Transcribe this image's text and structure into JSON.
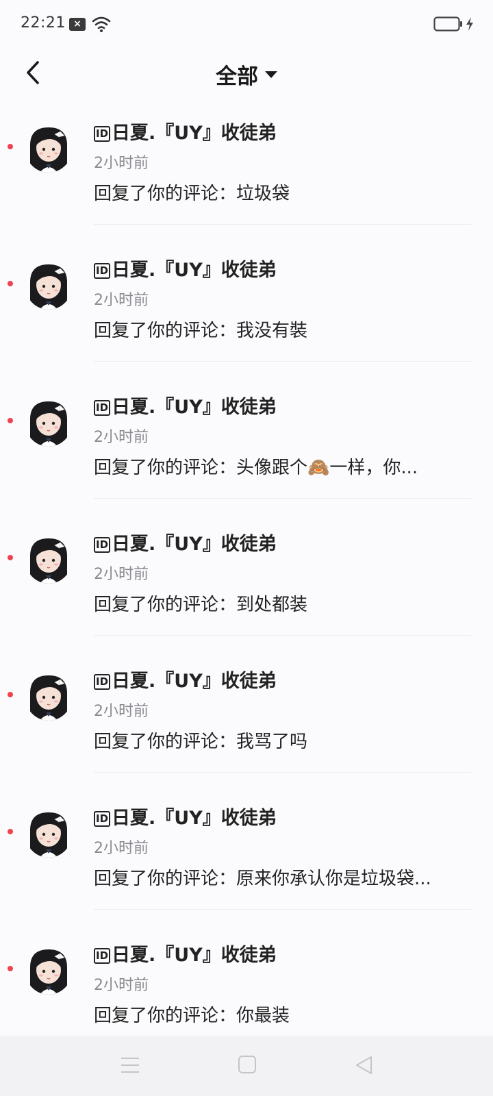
{
  "status": {
    "time": "22:21",
    "notif_icon": "x-icon",
    "wifi_icon": "wifi-icon",
    "battery_icon": "battery-icon"
  },
  "header": {
    "back_icon": "chevron-left-icon",
    "title": "全部",
    "dropdown_icon": "caret-down-icon"
  },
  "notifications": [
    {
      "id_badge": "ID",
      "user": "日夏.『UY』收徒弟",
      "time": "2小时前",
      "text": "回复了你的评论：垃圾袋",
      "unread": true
    },
    {
      "id_badge": "ID",
      "user": "日夏.『UY』收徒弟",
      "time": "2小时前",
      "text": "回复了你的评论：我没有裝",
      "unread": true
    },
    {
      "id_badge": "ID",
      "user": "日夏.『UY』收徒弟",
      "time": "2小时前",
      "text": "回复了你的评论：头像跟个🙈一样，你...",
      "unread": true
    },
    {
      "id_badge": "ID",
      "user": "日夏.『UY』收徒弟",
      "time": "2小时前",
      "text": "回复了你的评论：到处都装",
      "unread": true
    },
    {
      "id_badge": "ID",
      "user": "日夏.『UY』收徒弟",
      "time": "2小时前",
      "text": "回复了你的评论：我骂了吗",
      "unread": true
    },
    {
      "id_badge": "ID",
      "user": "日夏.『UY』收徒弟",
      "time": "2小时前",
      "text": "回复了你的评论：原来你承认你是垃圾袋...",
      "unread": true
    },
    {
      "id_badge": "ID",
      "user": "日夏.『UY』收徒弟",
      "time": "2小时前",
      "text": "回复了你的评论：你最装",
      "unread": true
    }
  ],
  "system_nav": {
    "menu_icon": "menu-icon",
    "home_icon": "square-home-icon",
    "back_icon": "triangle-back-icon"
  },
  "colors": {
    "unread_dot": "#f0434f",
    "background": "#fbfbfd",
    "nav_background": "#f2f2f4"
  }
}
